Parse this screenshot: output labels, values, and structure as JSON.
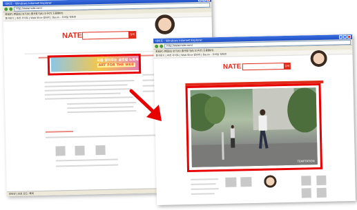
{
  "window_back": {
    "title": "네이트 - Windows Internet Explorer",
    "url": "http://www.nate.com/",
    "menu": "파일(F)  편집(E)  보기(V)  즐겨찾기(A)  도구(T)  도움말(H)",
    "favorites": "즐겨찾기  |  추천 사이트  |  Web Slice 갤러리  |  Daum - 모바일 첫화면",
    "logo": "NATE",
    "search_button": "검색",
    "banner_line1": "요즘 알아주는 글로벌 노트북",
    "banner_line2": "ART FOR THE WEB",
    "status": "인터넷 | 보호 모드: 해제"
  },
  "window_front": {
    "title": "네이트 - Windows Internet Explorer",
    "url": "http://www.nate.com/",
    "menu": "파일(F)  편집(E)  보기(V)  즐겨찾기(A)  도구(T)  도움말(H)",
    "favorites": "즐겨찾기  |  추천 사이트  |  Web Slice 갤러리  |  Daum - 모바일 첫화면",
    "logo": "NATE",
    "search_button": "검색",
    "video_caption": "TEMPTATION"
  },
  "colors": {
    "highlight": "#e80000",
    "brand": "#e02a1a"
  }
}
